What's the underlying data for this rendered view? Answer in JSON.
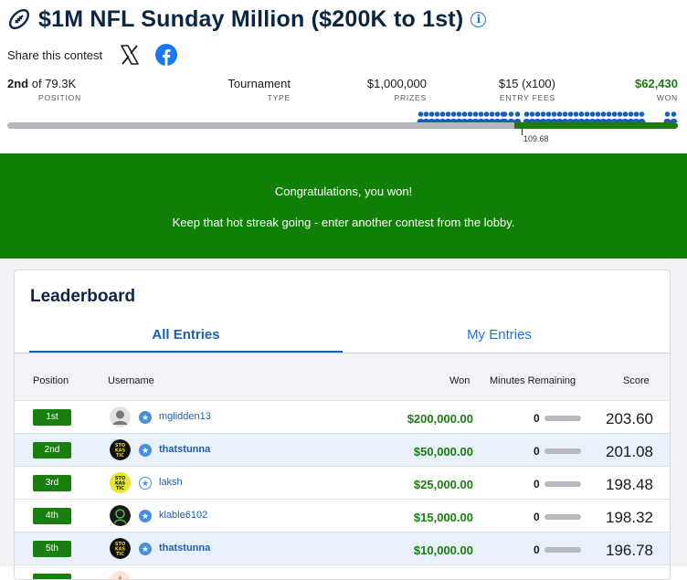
{
  "contest": {
    "title": "$1M NFL Sunday Million ($200K to 1st)",
    "share_label": "Share this contest"
  },
  "stats": {
    "position_rank": "2nd",
    "position_of": "of 79.3K",
    "position_label": "POSITION",
    "type_value": "Tournament",
    "type_label": "TYPE",
    "prizes_value": "$1,000,000",
    "prizes_label": "PRIZES",
    "entry_value": "$15 (x100)",
    "entry_label": "ENTRY FEES",
    "won_value": "$62,430",
    "won_label": "WON"
  },
  "progress": {
    "cash_line_label": "109.68"
  },
  "banner": {
    "line1": "Congratulations, you won!",
    "line2": "Keep that hot streak going - enter another contest from the lobby."
  },
  "leaderboard": {
    "title": "Leaderboard",
    "tabs": [
      "All Entries",
      "My Entries"
    ],
    "columns": [
      "Position",
      "Username",
      "Won",
      "Minutes Remaining",
      "Score"
    ],
    "rows": [
      {
        "position": "1st",
        "username": "mglidden13",
        "won": "$200,000.00",
        "minutes": "0",
        "score": "203.60"
      },
      {
        "position": "2nd",
        "username": "thatstunna",
        "won": "$50,000.00",
        "minutes": "0",
        "score": "201.08"
      },
      {
        "position": "3rd",
        "username": "laksh",
        "won": "$25,000.00",
        "minutes": "0",
        "score": "198.48"
      },
      {
        "position": "4th",
        "username": "klable6102",
        "won": "$15,000.00",
        "minutes": "0",
        "score": "198.32"
      },
      {
        "position": "5th",
        "username": "thatstunna",
        "won": "$10,000.00",
        "minutes": "0",
        "score": "196.78"
      }
    ]
  },
  "colors": {
    "brand_navy": "#0b2545",
    "win_green": "#118007",
    "link_blue": "#1a5fb4",
    "highlight_row": "#e8f1fa"
  }
}
